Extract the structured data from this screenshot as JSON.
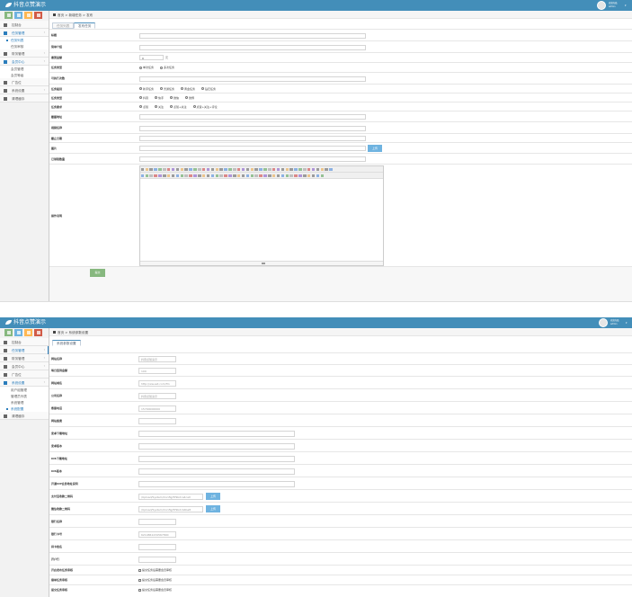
{
  "app": {
    "title": "抖音点赞演示",
    "user_line1": "欢迎光临",
    "user_line2": "admin"
  },
  "colors": {
    "header": "#438eb9",
    "shortcut_green": "#87b87f",
    "shortcut_blue": "#6fb3e0",
    "shortcut_orange": "#ffb752",
    "shortcut_red": "#d15b47",
    "submit_green": "#87b87f",
    "upload_blue": "#6fb3e0"
  },
  "top": {
    "nav": [
      {
        "label": "控制台",
        "icon": "dashboard-icon",
        "arrow": ""
      },
      {
        "label": "任务管理",
        "icon": "flag-icon",
        "arrow": "‹",
        "open": true
      },
      {
        "label": "财务管理",
        "icon": "money-icon",
        "arrow": "‹"
      },
      {
        "label": "会员中心",
        "icon": "user-icon",
        "arrow": "‹",
        "open": true
      },
      {
        "label": "广告位",
        "icon": "picture-icon",
        "arrow": ""
      },
      {
        "label": "系统设置",
        "icon": "gear-icon",
        "arrow": "‹"
      },
      {
        "label": "清理缓存",
        "icon": "trash-icon",
        "arrow": ""
      }
    ],
    "subnav_task": [
      "任务列表",
      "任务审核"
    ],
    "subnav_member": [
      "会员管理",
      "会员等级"
    ],
    "breadcrumb": "首页 > 新增任务 > 发布",
    "tabs": [
      "任务列表",
      "发布任务"
    ],
    "fields": [
      {
        "label": "标题"
      },
      {
        "label": "简单介绍"
      },
      {
        "label": "悬赏金额",
        "value": "0",
        "suffix": "元"
      },
      {
        "label": "任务类型",
        "options": [
          "单次任务",
          "多次任务"
        ]
      },
      {
        "label": "可执行次数"
      },
      {
        "label": "任务级别",
        "options": [
          "新手任务",
          "普通任务",
          "黄金任务",
          "钻石任务"
        ]
      },
      {
        "label": "任务类型",
        "options": [
          "抖音",
          "快手",
          "微信",
          "微博"
        ]
      },
      {
        "label": "任务要求",
        "options": [
          "点赞",
          "关注",
          "点赞+关注",
          "点赞+关注+评论"
        ]
      },
      {
        "label": "截图地址"
      },
      {
        "label": "视频名称"
      },
      {
        "label": "截止日期"
      },
      {
        "label": "图片",
        "button": "上传"
      },
      {
        "label": "已领取数量"
      },
      {
        "label": "操作说明"
      }
    ],
    "submit": "提交"
  },
  "bottom": {
    "nav": [
      {
        "label": "控制台",
        "icon": "dashboard-icon",
        "arrow": ""
      },
      {
        "label": "任务管理",
        "icon": "flag-icon",
        "arrow": "‹"
      },
      {
        "label": "财务管理",
        "icon": "money-icon",
        "arrow": "‹"
      },
      {
        "label": "会员中心",
        "icon": "user-icon",
        "arrow": "‹"
      },
      {
        "label": "广告位",
        "icon": "picture-icon",
        "arrow": ""
      },
      {
        "label": "系统设置",
        "icon": "gear-icon",
        "arrow": "‹",
        "open": true
      },
      {
        "label": "清理缓存",
        "icon": "trash-icon",
        "arrow": ""
      }
    ],
    "subnav_system": [
      "用户组管理",
      "管理员列表",
      "系统管理",
      "系统配置"
    ],
    "breadcrumb": "首页 > 系统参数设置",
    "tab": "系统参数设置",
    "fields": [
      {
        "label": "网站名称",
        "value": "抖音点赞演示",
        "w": 42
      },
      {
        "label": "每日签到金额",
        "value": "100",
        "w": 42
      },
      {
        "label": "网站域名",
        "value": "http://ww.sat.com/fm",
        "w": 42
      },
      {
        "label": "公司名称",
        "value": "抖音点赞演示",
        "w": 42
      },
      {
        "label": "客服电话",
        "value": "15700000000",
        "w": 42
      },
      {
        "label": "网站备案",
        "value": "",
        "w": 42
      },
      {
        "label": "安卓下载地址",
        "value": "",
        "w": 174
      },
      {
        "label": "安卓版本",
        "value": "",
        "w": 174
      },
      {
        "label": "IOS下载地址",
        "value": "",
        "w": 174
      },
      {
        "label": "IOS版本",
        "value": "",
        "w": 174
      },
      {
        "label": "开通VIP会员地址说明",
        "value": "",
        "w": 174
      },
      {
        "label": "支付宝收款二维码",
        "value": "/Upload/System/Config/5f9b2ca4ca0",
        "w": 72,
        "button": "上传"
      },
      {
        "label": "微信收款二维码",
        "value": "/Upload/System/Config/5f9b2cb4ba8",
        "w": 72,
        "button": "上传"
      },
      {
        "label": "银行名称",
        "value": "",
        "w": 42
      },
      {
        "label": "银行卡号",
        "value": "6214861234567890",
        "w": 42
      },
      {
        "label": "持卡姓名",
        "value": "",
        "w": 42
      },
      {
        "label": "开户行",
        "value": "",
        "w": 42
      },
      {
        "label": "开启发布任务审核",
        "check": "提交任务后需要会员审核"
      },
      {
        "label": "接单任务审核",
        "check": "提交任务后需要会员审核"
      },
      {
        "label": "提交任务审核",
        "check": "提交任务后需要会员审核"
      }
    ]
  }
}
